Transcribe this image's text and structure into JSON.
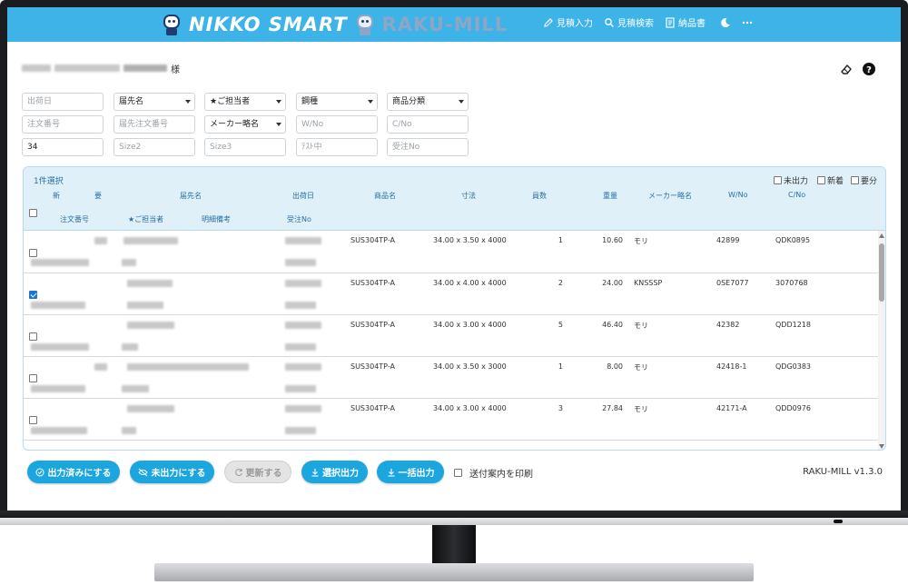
{
  "header": {
    "brand_primary": "NIKKO SMART",
    "brand_secondary": "RAKU-MILL",
    "nav": [
      {
        "label": "見積入力",
        "icon": "pencil-icon"
      },
      {
        "label": "見積検索",
        "icon": "search-icon"
      },
      {
        "label": "納品書",
        "icon": "document-icon"
      }
    ],
    "theme_icon": "moon-icon",
    "more_icon": "more-icon"
  },
  "customer": {
    "suffix": "様"
  },
  "filters": {
    "ship_date": {
      "placeholder": "出荷日"
    },
    "destination": {
      "value": "届先名"
    },
    "staff": {
      "value": "★ご担当者"
    },
    "steel_type": {
      "value": "鋼種"
    },
    "product_category": {
      "value": "商品分類"
    },
    "order_no": {
      "placeholder": "注文番号"
    },
    "dest_order_no": {
      "placeholder": "届先注文番号"
    },
    "maker": {
      "value": "メーカー略名"
    },
    "w_no": {
      "placeholder": "W/No"
    },
    "c_no": {
      "placeholder": "C/No"
    },
    "size1": {
      "value": "34"
    },
    "size2": {
      "placeholder": "Size2"
    },
    "size3": {
      "placeholder": "Size3"
    },
    "test_cert": {
      "placeholder": "ﾃｽﾄ中"
    },
    "order_receipt_no": {
      "placeholder": "受注No"
    }
  },
  "table": {
    "selection_count": "1件選択",
    "options": [
      "未出力",
      "新着",
      "要分"
    ],
    "headers_row1": [
      "新",
      "要",
      "届先名",
      "出荷日",
      "商品名",
      "寸法",
      "員数",
      "重量",
      "メーカー略名",
      "W/No",
      "C/No"
    ],
    "headers_row2": [
      "注文番号",
      "★ご担当者",
      "明細備考",
      "受注No"
    ],
    "rows": [
      {
        "checked": false,
        "product": "SUS304TP-A",
        "dims": "34.00 x 3.50 x 4000",
        "qty": "1",
        "weight": "10.60",
        "maker": "モリ",
        "w_no": "42899",
        "c_no": "QDK0895"
      },
      {
        "checked": true,
        "product": "SUS304TP-A",
        "dims": "34.00 x 4.00 x 4000",
        "qty": "2",
        "weight": "24.00",
        "maker": "KNSSSP",
        "w_no": "0SE7077",
        "c_no": "3070768"
      },
      {
        "checked": false,
        "product": "SUS304TP-A",
        "dims": "34.00 x 3.00 x 4000",
        "qty": "5",
        "weight": "46.40",
        "maker": "モリ",
        "w_no": "42382",
        "c_no": "QDD1218"
      },
      {
        "checked": false,
        "product": "SUS304TP-A",
        "dims": "34.00 x 3.50 x 3000",
        "qty": "1",
        "weight": "8.00",
        "maker": "モリ",
        "w_no": "42418-1",
        "c_no": "QDG0383"
      },
      {
        "checked": false,
        "product": "SUS304TP-A",
        "dims": "34.00 x 3.00 x 4000",
        "qty": "3",
        "weight": "27.84",
        "maker": "モリ",
        "w_no": "42171-A",
        "c_no": "QDD0976"
      }
    ]
  },
  "actions": {
    "mark_output": "出力済みにする",
    "mark_unoutput": "未出力にする",
    "update": "更新する",
    "selected_output": "選択出力",
    "bulk_output": "一括出力",
    "print_label": "送付案内を印刷"
  },
  "version": "RAKU-MILL v1.3.0"
}
